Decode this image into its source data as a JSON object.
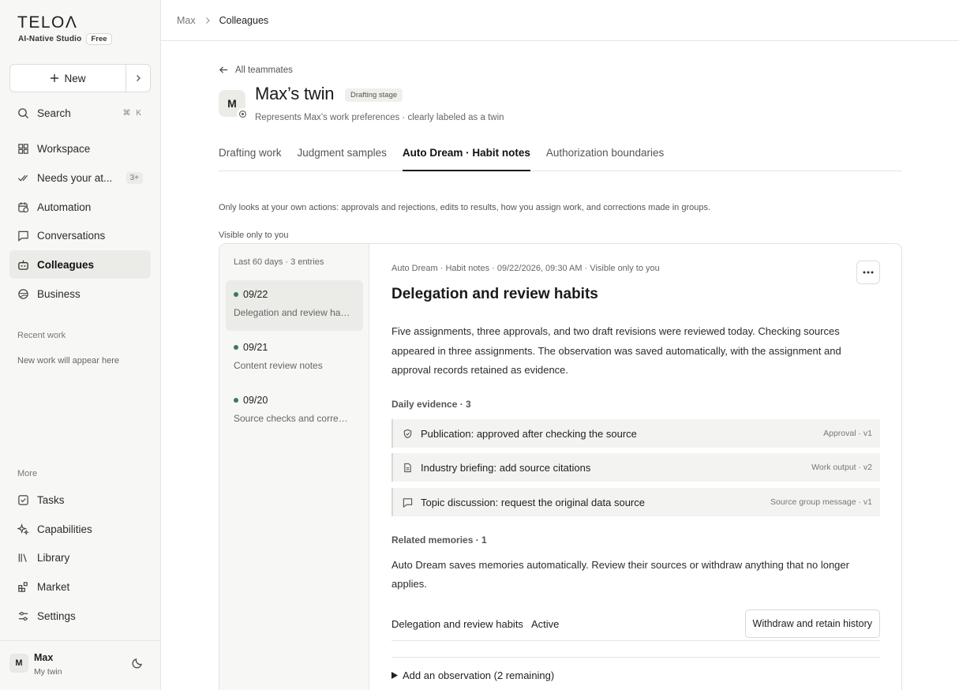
{
  "sidebar": {
    "logo": "TELOΛ",
    "studio": "AI-Native Studio",
    "plan": "Free",
    "new_label": "New",
    "items": [
      {
        "label": "Search",
        "shortcut": "⌘ K"
      },
      {
        "label": "Workspace"
      },
      {
        "label": "Needs your at...",
        "count": "3+"
      },
      {
        "label": "Automation"
      },
      {
        "label": "Conversations"
      },
      {
        "label": "Colleagues"
      },
      {
        "label": "Business"
      }
    ],
    "recent_label": "Recent work",
    "recent_empty": "New work will appear here",
    "more_label": "More",
    "more_items": [
      {
        "label": "Tasks"
      },
      {
        "label": "Capabilities"
      },
      {
        "label": "Library"
      },
      {
        "label": "Market"
      },
      {
        "label": "Settings"
      }
    ],
    "user": {
      "initial": "M",
      "name": "Max",
      "subtitle": "My twin"
    }
  },
  "breadcrumb": {
    "parent": "Max",
    "current": "Colleagues"
  },
  "header": {
    "back_label": "All teammates",
    "avatar_initial": "M",
    "title": "Max’s twin",
    "stage": "Drafting stage",
    "description": "Represents Max’s work preferences · clearly labeled as a twin"
  },
  "tabs": [
    {
      "label": "Drafting work"
    },
    {
      "label": "Judgment samples"
    },
    {
      "label": "Auto Dream · Habit notes"
    },
    {
      "label": "Authorization boundaries"
    }
  ],
  "intro": "Only looks at your own actions: approvals and rejections, edits to results, how you assign work, and corrections made in groups.",
  "visible_label": "Visible only to you",
  "entries_header": "Last 60 days · 3 entries",
  "entries": [
    {
      "date": "09/22",
      "title": "Delegation and review habits"
    },
    {
      "date": "09/21",
      "title": "Content review notes"
    },
    {
      "date": "09/20",
      "title": "Source checks and corrections"
    }
  ],
  "detail": {
    "meta": "Auto Dream · Habit notes · 09/22/2026, 09:30 AM · Visible only to you",
    "title": "Delegation and review habits",
    "summary": "Five assignments, three approvals, and two draft revisions were reviewed today. Checking sources appeared in three assignments. The observation was saved automatically, with the assignment and approval records retained as evidence.",
    "evidence_heading": "Daily evidence · 3",
    "evidence": [
      {
        "text": "Publication: approved after checking the source",
        "tag": "Approval · v1",
        "icon": "shield-check-icon"
      },
      {
        "text": "Industry briefing: add source citations",
        "tag": "Work output · v2",
        "icon": "document-icon"
      },
      {
        "text": "Topic discussion: request the original data source",
        "tag": "Source group message · v1",
        "icon": "chat-bubble-icon"
      }
    ],
    "memories_heading": "Related memories · 1",
    "memories_text": "Auto Dream saves memories automatically. Review their sources or withdraw anything that no longer applies.",
    "memory": {
      "name": "Delegation and review habits",
      "status": "Active",
      "action": "Withdraw and retain history"
    },
    "add_observation": "Add an observation (2 remaining)"
  },
  "colors": {
    "accent_dot": "#3b7a57",
    "sidebar_bg": "#f7f7f5",
    "active_bg": "#ebebe8"
  }
}
